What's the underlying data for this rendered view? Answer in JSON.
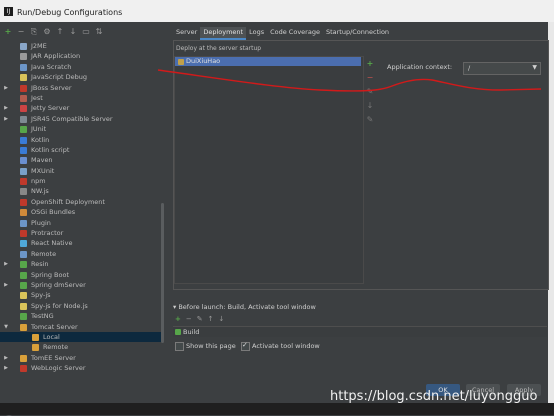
{
  "window": {
    "title": "Run/Debug Configurations",
    "app_icon": "intellij-icon"
  },
  "left_toolbar": [
    "add",
    "remove",
    "copy",
    "settings",
    "move-up",
    "move-down",
    "folder",
    "sort"
  ],
  "tree": [
    {
      "label": "J2ME",
      "level": 1,
      "arrow": "",
      "icon_color": "#8aa7c9"
    },
    {
      "label": "JAR Application",
      "level": 1,
      "arrow": "",
      "icon_color": "#9a9a9a"
    },
    {
      "label": "Java Scratch",
      "level": 1,
      "arrow": "",
      "icon_color": "#6c96c8"
    },
    {
      "label": "JavaScript Debug",
      "level": 1,
      "arrow": "",
      "icon_color": "#d9c35a"
    },
    {
      "label": "JBoss Server",
      "level": 1,
      "arrow": "▶",
      "icon_color": "#c0392b"
    },
    {
      "label": "Jest",
      "level": 1,
      "arrow": "",
      "icon_color": "#b25c4f"
    },
    {
      "label": "Jetty Server",
      "level": 1,
      "arrow": "▶",
      "icon_color": "#c44"
    },
    {
      "label": "JSR45 Compatible Server",
      "level": 1,
      "arrow": "▶",
      "icon_color": "#7e8a92"
    },
    {
      "label": "JUnit",
      "level": 1,
      "arrow": "",
      "icon_color": "#57a64a"
    },
    {
      "label": "Kotlin",
      "level": 1,
      "arrow": "",
      "icon_color": "#3a7bd5"
    },
    {
      "label": "Kotlin script",
      "level": 1,
      "arrow": "",
      "icon_color": "#3a7bd5"
    },
    {
      "label": "Maven",
      "level": 1,
      "arrow": "",
      "icon_color": "#6a8fd0"
    },
    {
      "label": "MXUnit",
      "level": 1,
      "arrow": "",
      "icon_color": "#7aa0c8"
    },
    {
      "label": "npm",
      "level": 1,
      "arrow": "",
      "icon_color": "#c0392b"
    },
    {
      "label": "NW.js",
      "level": 1,
      "arrow": "",
      "icon_color": "#888"
    },
    {
      "label": "OpenShift Deployment",
      "level": 1,
      "arrow": "",
      "icon_color": "#c0392b"
    },
    {
      "label": "OSGi Bundles",
      "level": 1,
      "arrow": "",
      "icon_color": "#d08a3a"
    },
    {
      "label": "Plugin",
      "level": 1,
      "arrow": "",
      "icon_color": "#6c96c8"
    },
    {
      "label": "Protractor",
      "level": 1,
      "arrow": "",
      "icon_color": "#c0392b"
    },
    {
      "label": "React Native",
      "level": 1,
      "arrow": "",
      "icon_color": "#4fa8d8"
    },
    {
      "label": "Remote",
      "level": 1,
      "arrow": "",
      "icon_color": "#6c96c8"
    },
    {
      "label": "Resin",
      "level": 1,
      "arrow": "▶",
      "icon_color": "#57a64a"
    },
    {
      "label": "Spring Boot",
      "level": 1,
      "arrow": "",
      "icon_color": "#57a64a"
    },
    {
      "label": "Spring dmServer",
      "level": 1,
      "arrow": "▶",
      "icon_color": "#57a64a"
    },
    {
      "label": "Spy-js",
      "level": 1,
      "arrow": "",
      "icon_color": "#d9c35a"
    },
    {
      "label": "Spy-js for Node.js",
      "level": 1,
      "arrow": "",
      "icon_color": "#d9c35a"
    },
    {
      "label": "TestNG",
      "level": 1,
      "arrow": "",
      "icon_color": "#57a64a"
    },
    {
      "label": "Tomcat Server",
      "level": 1,
      "arrow": "▼",
      "icon_color": "#d9a03a"
    },
    {
      "label": "Local",
      "level": 2,
      "arrow": "",
      "icon_color": "#d9a03a",
      "selected": true
    },
    {
      "label": "Remote",
      "level": 2,
      "arrow": "",
      "icon_color": "#d9a03a"
    },
    {
      "label": "TomEE Server",
      "level": 1,
      "arrow": "▶",
      "icon_color": "#d9a03a"
    },
    {
      "label": "WebLogic Server",
      "level": 1,
      "arrow": "▶",
      "icon_color": "#c0392b"
    }
  ],
  "tabs": [
    {
      "label": "Server",
      "active": false
    },
    {
      "label": "Deployment",
      "active": true
    },
    {
      "label": "Logs",
      "active": false
    },
    {
      "label": "Code Coverage",
      "active": false
    },
    {
      "label": "Startup/Connection",
      "active": false
    }
  ],
  "deployment": {
    "section_label": "Deploy at the server startup",
    "items": [
      "DuiXiuHao"
    ],
    "side_tools": [
      "+",
      "−",
      "✎",
      "↓",
      "✎"
    ],
    "context_label": "Application context:",
    "context_value": "/"
  },
  "before_launch": {
    "header": "Before launch: Build, Activate tool window",
    "tools": [
      "+",
      "−",
      "✎",
      "↑",
      "↓"
    ],
    "items": [
      "Build"
    ],
    "show_page_label": "Show this page",
    "show_page_checked": false,
    "activate_label": "Activate tool window",
    "activate_checked": true
  },
  "buttons": {
    "ok": "OK",
    "cancel": "Cancel",
    "apply": "Apply"
  },
  "help": "?",
  "watermark": "https://blog.csdn.net/luyongguo",
  "annotation_color": "#d11a1a"
}
